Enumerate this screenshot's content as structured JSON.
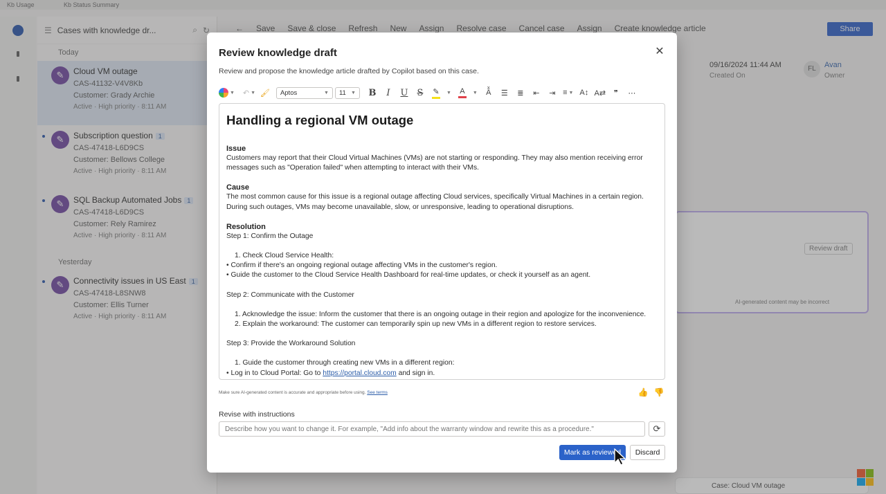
{
  "app": {
    "top_tabs": [
      "Kb Usage",
      "Kb Status Summary"
    ],
    "caselist": {
      "title": "Cases with knowledge dr...",
      "groups": [
        {
          "label": "Today"
        },
        {
          "label": "Yesterday"
        }
      ],
      "cases": [
        {
          "title": "Cloud VM outage",
          "id": "CAS-41132-V4V8Kb",
          "customer": "Customer: Grady Archie",
          "status": "Active · High priority · 8:11 AM",
          "badge": ""
        },
        {
          "title": "Subscription question",
          "id": "CAS-47418-L6D9CS",
          "customer": "Customer: Bellows College",
          "status": "Active · High priority · 8:11 AM",
          "badge": "1"
        },
        {
          "title": "SQL Backup Automated Jobs",
          "id": "CAS-47418-L6D9CS",
          "customer": "Customer: Rely Ramirez",
          "status": "Active · High priority · 8:11 AM",
          "badge": "1"
        },
        {
          "title": "Connectivity issues in US East",
          "id": "CAS-47418-L8SNW8",
          "customer": "Customer: Ellis Turner",
          "status": "Active · High priority · 8:11 AM",
          "badge": "1"
        }
      ]
    },
    "commands": [
      "Save",
      "Save & close",
      "Refresh",
      "New",
      "Assign",
      "Resolve case",
      "Cancel case",
      "Assign",
      "Create knowledge article"
    ],
    "share_label": "Share",
    "right": {
      "date": "09/16/2024 11:44 AM",
      "date_label": "Created On",
      "owner_initials": "FL",
      "owner_name": "Avan",
      "owner_role": "Owner",
      "review_draft": "Review draft",
      "ai_note": "AI-generated content may be incorrect",
      "case_ref": "Case: Cloud VM outage"
    }
  },
  "modal": {
    "title": "Review knowledge draft",
    "subtitle": "Review and propose the knowledge article drafted by Copilot based on this case.",
    "toolbar": {
      "font": "Aptos",
      "size": "11"
    },
    "article": {
      "title": "Handling a regional VM outage",
      "issue_heading": "Issue",
      "issue_text": "Customers may report that their Cloud Virtual Machines (VMs) are not starting or responding. They may also mention receiving error messages such as \"Operation failed\" when attempting to interact with their VMs.",
      "cause_heading": "Cause",
      "cause_text": "The most common cause for this issue is a regional outage affecting Cloud services, specifically Virtual Machines in a certain region. During such outages, VMs may become unavailable, slow, or unresponsive, leading to operational disruptions.",
      "resolution_heading": "Resolution",
      "step1": "Step 1: Confirm the Outage",
      "step1_items": [
        "1. Check Cloud Service Health:",
        "• Confirm if there's an ongoing regional outage affecting VMs in the customer's region.",
        "• Guide the customer to the Cloud Service Health Dashboard for real-time updates, or check it yourself as an agent."
      ],
      "step2": "Step 2: Communicate with the Customer",
      "step2_items": [
        "1. Acknowledge the issue: Inform the customer that there is an ongoing outage in their region and apologize for the inconvenience.",
        "2. Explain the workaround: The customer can temporarily spin up new VMs in a different region to restore services."
      ],
      "step3": "Step 3: Provide the Workaround Solution",
      "step3_item1": "1. Guide the customer through creating new VMs in a different region:",
      "step3_item2_prefix": "• Log in to Cloud Portal: Go to ",
      "step3_item2_link": "https://portal.cloud.com",
      "step3_item2_suffix": " and sign in."
    },
    "disclaimer": "Make sure AI-generated content is accurate and appropriate before using.",
    "disclaimer_link": "See terms",
    "revise_label": "Revise with instructions",
    "revise_placeholder": "Describe how you want to change it. For example, \"Add info about the warranty window and rewrite this as a procedure.\"",
    "primary_button": "Mark as reviewed",
    "secondary_button": "Discard"
  },
  "colors": {
    "accent": "#2b62c9",
    "overlay": "#5a5a5a",
    "avatar": "#6a3f9e"
  }
}
